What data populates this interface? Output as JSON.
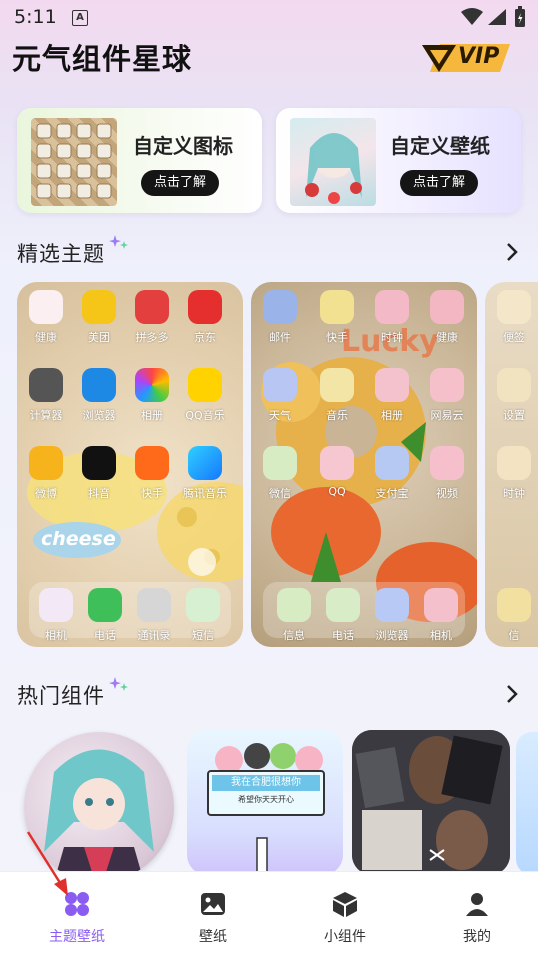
{
  "status_bar": {
    "time": "5:11",
    "notification_badge": "A"
  },
  "header": {
    "title": "元气组件星球",
    "vip_label": "VIP"
  },
  "feature_cards": [
    {
      "title": "自定义图标",
      "button": "点击了解"
    },
    {
      "title": "自定义壁纸",
      "button": "点击了解"
    }
  ],
  "sections": {
    "featured": "精选主题",
    "hot": "热门组件"
  },
  "themes": [
    {
      "apps": [
        "健康",
        "美团",
        "拼多多",
        "京东",
        "计算器",
        "浏览器",
        "相册",
        "QQ音乐",
        "微博",
        "抖音",
        "快手",
        "腾讯音乐"
      ],
      "dock": [
        "相机",
        "电话",
        "通讯录",
        "短信"
      ],
      "decor_text": "cheese"
    },
    {
      "apps": [
        "邮件",
        "快手",
        "时钟",
        "健康",
        "天气",
        "音乐",
        "相册",
        "网易云",
        "微信",
        "QQ",
        "支付宝",
        "视频"
      ],
      "dock": [
        "信息",
        "电话",
        "浏览器",
        "相机"
      ],
      "decor_text": "Lucky"
    },
    {
      "apps": [
        "便签",
        "设置",
        "时钟"
      ],
      "dock": [
        "信"
      ]
    }
  ],
  "widgets": {
    "sign_line1": "我在合肥很想你",
    "sign_line2": "希望你天天开心"
  },
  "tabs": [
    {
      "label": "主题壁纸",
      "icon": "theme-icon",
      "active": true
    },
    {
      "label": "壁纸",
      "icon": "image-icon",
      "active": false
    },
    {
      "label": "小组件",
      "icon": "cube-icon",
      "active": false
    },
    {
      "label": "我的",
      "icon": "profile-icon",
      "active": false
    }
  ],
  "colors": {
    "accent": "#8a5cf2",
    "vip_gold": "#f5b73c",
    "button_dark": "#151515"
  }
}
